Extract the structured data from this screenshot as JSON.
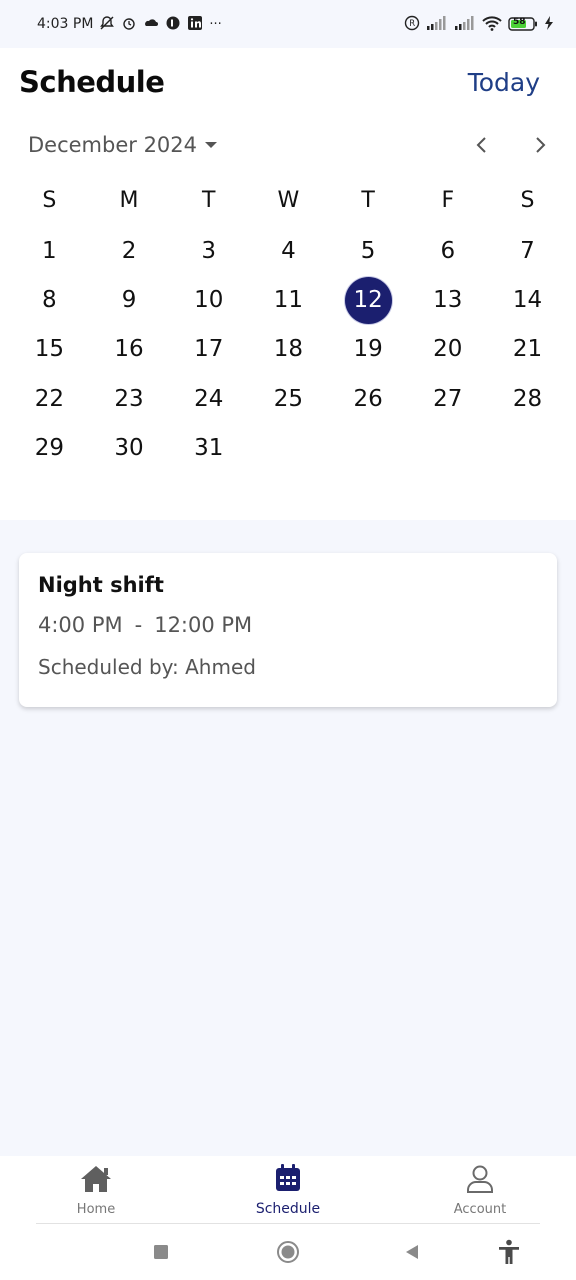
{
  "status_bar": {
    "time": "4:03 PM",
    "left_icons": [
      "bell-off-icon",
      "alarm-icon",
      "cloud-icon",
      "app-icon",
      "linkedin-icon",
      "more-dots-icon"
    ],
    "more": "···",
    "right_icons": [
      "registered-icon",
      "signal-icon",
      "signal-icon",
      "wifi-icon",
      "battery-icon",
      "charging-icon"
    ],
    "battery": "58"
  },
  "header": {
    "title": "Schedule",
    "today_label": "Today"
  },
  "calendar": {
    "month_label": "December 2024",
    "weekdays": [
      "S",
      "M",
      "T",
      "W",
      "T",
      "F",
      "S"
    ],
    "days": [
      "1",
      "2",
      "3",
      "4",
      "5",
      "6",
      "7",
      "8",
      "9",
      "10",
      "11",
      "12",
      "13",
      "14",
      "15",
      "16",
      "17",
      "18",
      "19",
      "20",
      "21",
      "22",
      "23",
      "24",
      "25",
      "26",
      "27",
      "28",
      "29",
      "30",
      "31"
    ],
    "selected_day": "12",
    "accent_color": "#1b1f6f"
  },
  "shift": {
    "title": "Night shift",
    "start": "4:00 PM",
    "separator": "-",
    "end": "12:00 PM",
    "scheduled_by": "Scheduled by: Ahmed"
  },
  "bottom_nav": {
    "items": [
      {
        "label": "Home",
        "icon": "home-icon"
      },
      {
        "label": "Schedule",
        "icon": "calendar-icon"
      },
      {
        "label": "Account",
        "icon": "person-icon"
      }
    ],
    "active": "Schedule"
  }
}
